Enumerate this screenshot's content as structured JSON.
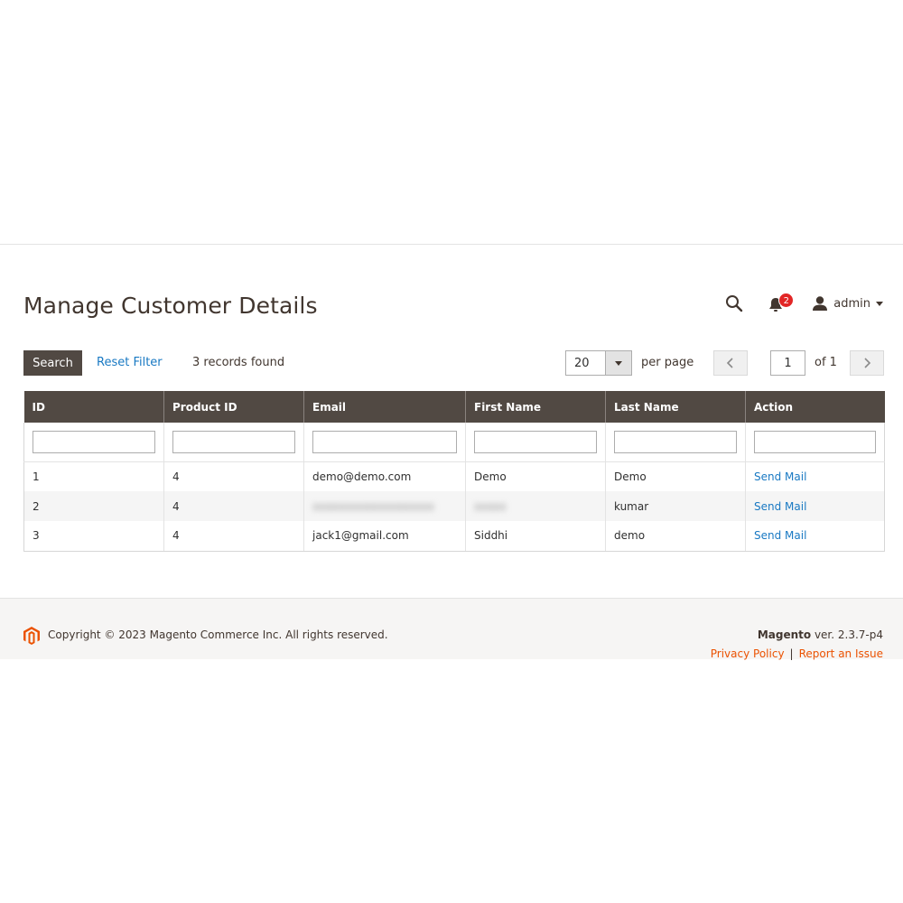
{
  "page_title": "Manage Customer Details",
  "header": {
    "notification_count": "2",
    "user_name": "admin"
  },
  "toolbar": {
    "search_label": "Search",
    "reset_label": "Reset Filter",
    "records_text": "3 records found",
    "per_page_value": "20",
    "per_page_label": "per page",
    "current_page": "1",
    "page_of": "of 1"
  },
  "grid": {
    "columns": [
      "ID",
      "Product ID",
      "Email",
      "First Name",
      "Last Name",
      "Action"
    ],
    "rows": [
      {
        "id": "1",
        "product_id": "4",
        "email": "demo@demo.com",
        "first_name": "Demo",
        "last_name": "Demo",
        "action": "Send Mail"
      },
      {
        "id": "2",
        "product_id": "4",
        "email": "xxxxxxxxxxxxxxxxxxx",
        "first_name": "xxxxx",
        "last_name": "kumar",
        "action": "Send Mail"
      },
      {
        "id": "3",
        "product_id": "4",
        "email": "jack1@gmail.com",
        "first_name": "Siddhi",
        "last_name": "demo",
        "action": "Send Mail"
      }
    ]
  },
  "footer": {
    "copyright": "Copyright © 2023 Magento Commerce Inc. All rights reserved.",
    "brand": "Magento",
    "version": "ver. 2.3.7-p4",
    "privacy_label": "Privacy Policy",
    "separator": "|",
    "report_label": "Report an Issue"
  },
  "colors": {
    "header_bg": "#514943",
    "link": "#1979c3",
    "footer_link": "#eb5202",
    "badge": "#e22626"
  },
  "icons": {
    "search": "search-icon",
    "notifications": "bell-icon",
    "user": "user-icon",
    "prev": "chevron-left-icon",
    "next": "chevron-right-icon",
    "logo": "magento-logo-icon"
  }
}
